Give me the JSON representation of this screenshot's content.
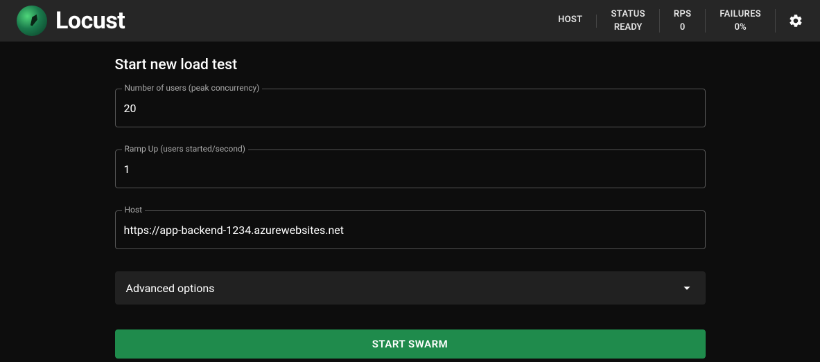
{
  "brand": {
    "name": "Locust"
  },
  "header": {
    "stats": [
      {
        "label": "HOST",
        "value": ""
      },
      {
        "label": "STATUS",
        "value": "READY"
      },
      {
        "label": "RPS",
        "value": "0"
      },
      {
        "label": "FAILURES",
        "value": "0%"
      }
    ]
  },
  "form": {
    "title": "Start new load test",
    "fields": {
      "users": {
        "label": "Number of users (peak concurrency)",
        "value": "20"
      },
      "ramp": {
        "label": "Ramp Up (users started/second)",
        "value": "1"
      },
      "host": {
        "label": "Host",
        "value": "https://app-backend-1234.azurewebsites.net"
      }
    },
    "advanced_label": "Advanced options",
    "submit_label": "START SWARM"
  }
}
